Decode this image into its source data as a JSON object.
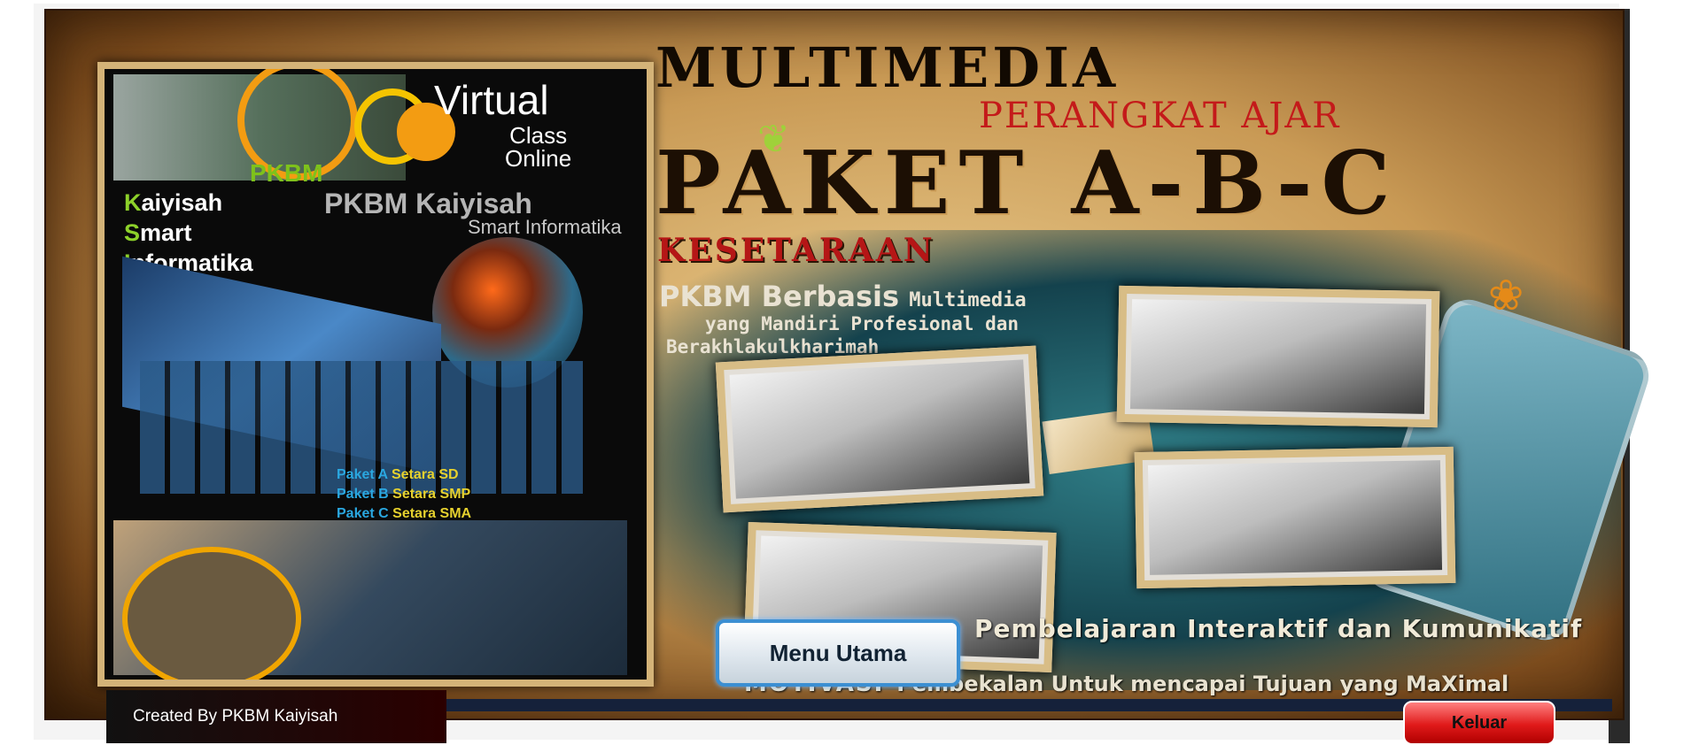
{
  "poster": {
    "virtual": "Virtual",
    "class_online": "Class\nOnline",
    "pkbm": "PKBM",
    "kaiyisah": "aiyisah",
    "kaiyisah_initial": "K",
    "smart": "mart",
    "smart_initial": "S",
    "informatika": "nformatika",
    "informatika_initial": "I",
    "pkbm_kaiyisah": "PKBM  Kaiyisah",
    "smart_informatika": "Smart Informatika",
    "paket_list": [
      {
        "paket": "Paket A",
        "setara": "Setara SD"
      },
      {
        "paket": "Paket B",
        "setara": "Setara SMP"
      },
      {
        "paket": "Paket C",
        "setara": "Setara SMA"
      }
    ]
  },
  "header": {
    "multimedia": "MULTIMEDIA",
    "perangkat_ajar": "PERANGKAT AJAR",
    "paket_abc": "PAKET A-B-C",
    "kesetaraan": "KESETARAAN"
  },
  "description": {
    "line1_big": "PKBM  Berbasis",
    "line1_small": "Multimedia",
    "line2": "yang Mandiri Profesional dan",
    "line3": "Berakhlakulkharimah"
  },
  "taglines": {
    "pembelajaran": "Pembelajaran Interaktif dan Kumunikatif",
    "motivasi_label": "MOTIVASI",
    "motivasi_text": "Pembekalan Untuk mencapai Tujuan yang MaXimal"
  },
  "buttons": {
    "menu_utama": "Menu Utama",
    "keluar": "Keluar"
  },
  "footer": {
    "credit": "Created By PKBM Kaiyisah"
  },
  "colors": {
    "parchment": "#c99a55",
    "title_red": "#c41a1a",
    "menu_border": "#3c8fd2",
    "keluar_red": "#e01a1a"
  }
}
